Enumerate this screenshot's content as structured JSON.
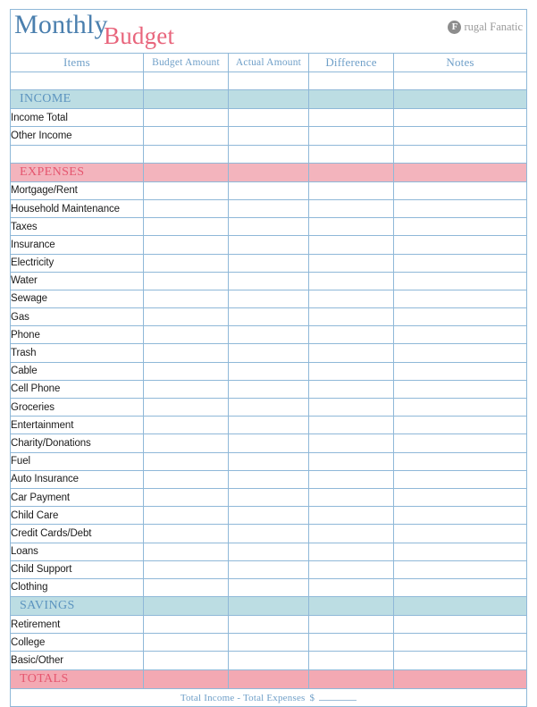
{
  "document": {
    "title_part1": "Monthly",
    "title_part2": "Budget"
  },
  "brand": {
    "mark": "F",
    "name": "rugal Fanatic",
    "full_name": "Frugal Fanatic"
  },
  "columns": [
    {
      "label": "Items"
    },
    {
      "label": "Budget Amount"
    },
    {
      "label": "Actual Amount"
    },
    {
      "label": "Difference"
    },
    {
      "label": "Notes"
    }
  ],
  "sections": [
    {
      "band": "INCOME",
      "band_style": "income",
      "rows": [
        "Income Total",
        "Other Income",
        ""
      ]
    },
    {
      "band": "EXPENSES",
      "band_style": "expenses",
      "rows": [
        "Mortgage/Rent",
        "Household Maintenance",
        "Taxes",
        "Insurance",
        "Electricity",
        "Water",
        "Sewage",
        "Gas",
        "Phone",
        "Trash",
        "Cable",
        "Cell Phone",
        "Groceries",
        "Entertainment",
        "Charity/Donations",
        "Fuel",
        "Auto Insurance",
        "Car Payment",
        "Child Care",
        "Credit Cards/Debt",
        "Loans",
        "Child Support",
        "Clothing"
      ]
    },
    {
      "band": "SAVINGS",
      "band_style": "savings",
      "rows": [
        "Retirement",
        "College",
        "Basic/Other"
      ]
    },
    {
      "band": "TOTALS",
      "band_style": "totals",
      "rows": []
    }
  ],
  "leading_blank_rows": 1,
  "footer": {
    "formula": "Total Income  -  Total Expenses",
    "currency": "$",
    "value": ""
  },
  "colors": {
    "border": "#8fb8d8",
    "header_text": "#6f9fc8",
    "income_band": "#bcdde3",
    "expenses_band": "#f3b4bd",
    "totals_band": "#f3a9b3",
    "title_blue": "#4a7fae",
    "title_pink": "#e8657c"
  }
}
